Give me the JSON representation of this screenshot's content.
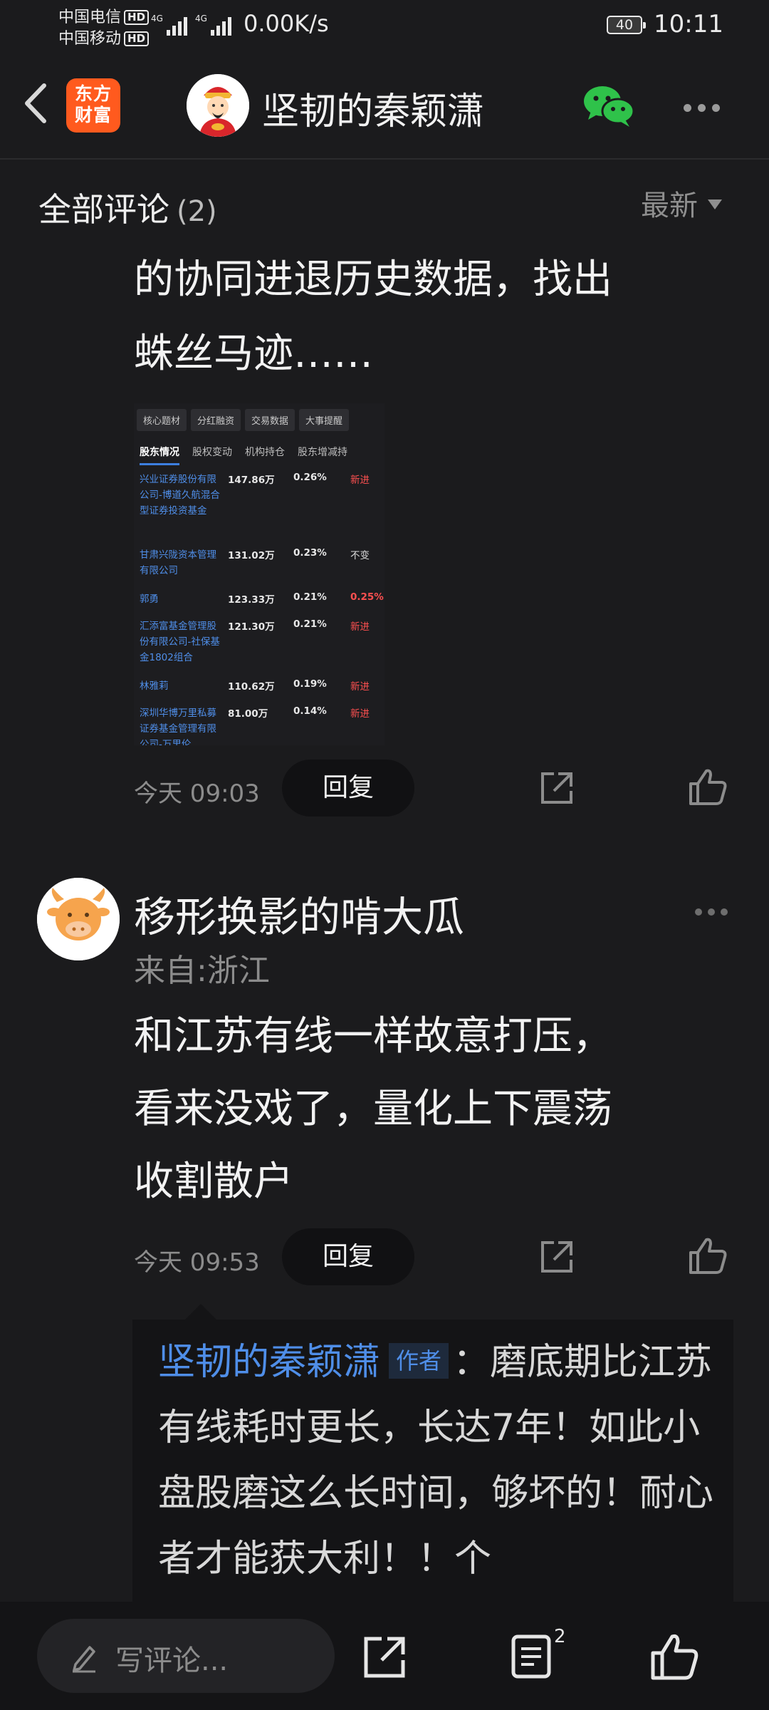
{
  "status": {
    "carrier1": "中国电信",
    "carrier2": "中国移动",
    "hd": "HD",
    "net_speed": "0.00K/s",
    "battery": "40",
    "time": "10:11"
  },
  "header": {
    "app_logo_line1": "东方",
    "app_logo_line2": "财富",
    "title": "坚韧的秦颖潇"
  },
  "comments_section": {
    "title": "全部评论",
    "count": "(2)",
    "sort_label": "最新"
  },
  "comment1": {
    "text_lines": [
      "的协同进退历史数据，找出",
      "蛛丝马迹……"
    ],
    "time": "今天 09:03",
    "reply_label": "回复"
  },
  "embedded_shot": {
    "tabs": [
      "核心题材",
      "分红融资",
      "交易数据",
      "大事提醒"
    ],
    "subtabs": [
      "股东情况",
      "股权变动",
      "机构持仓",
      "股东增减持"
    ],
    "rows": [
      {
        "name": "兴业证券股份有限公司-博道久航混合型证券投资基金",
        "qty": "147.86万",
        "pct": "0.26%",
        "change": "新进"
      },
      {
        "name": "甘肃兴陇资本管理有限公司",
        "qty": "131.02万",
        "pct": "0.23%",
        "change": "不变"
      },
      {
        "name": "郭勇",
        "qty": "123.33万",
        "pct": "0.21%",
        "change": "0.25%"
      },
      {
        "name": "汇添富基金管理股份有限公司-社保基金1802组合",
        "qty": "121.30万",
        "pct": "0.21%",
        "change": "新进"
      },
      {
        "name": "林雅莉",
        "qty": "110.62万",
        "pct": "0.19%",
        "change": "新进"
      },
      {
        "name": "深圳华博万里私募证券基金管理有限公司-万里伦",
        "qty": "81.00万",
        "pct": "0.14%",
        "change": "新进"
      }
    ]
  },
  "comment2": {
    "username": "移形换影的啃大瓜",
    "location": "来自:浙江",
    "text_lines": [
      "和江苏有线一样故意打压，",
      "看来没戏了，量化上下震荡",
      "收割散户"
    ],
    "time": "今天 09:53",
    "reply_label": "回复",
    "reply": {
      "author": "坚韧的秦颖潇",
      "tag": "作者",
      "text": "：磨底期比江苏有线耗时更长，长达7年！如此小盘股磨这么长时间，够坏的！耐心者才能获大利！！个"
    }
  },
  "bottom_bar": {
    "input_placeholder": "写评论...",
    "comment_count": "2"
  },
  "colors": {
    "background": "#1b1b1d",
    "accent_blue": "#4f8ee8",
    "brand_orange": "#ff5a1e",
    "wechat_green": "#2fc24a",
    "up_red": "#ff5050"
  }
}
